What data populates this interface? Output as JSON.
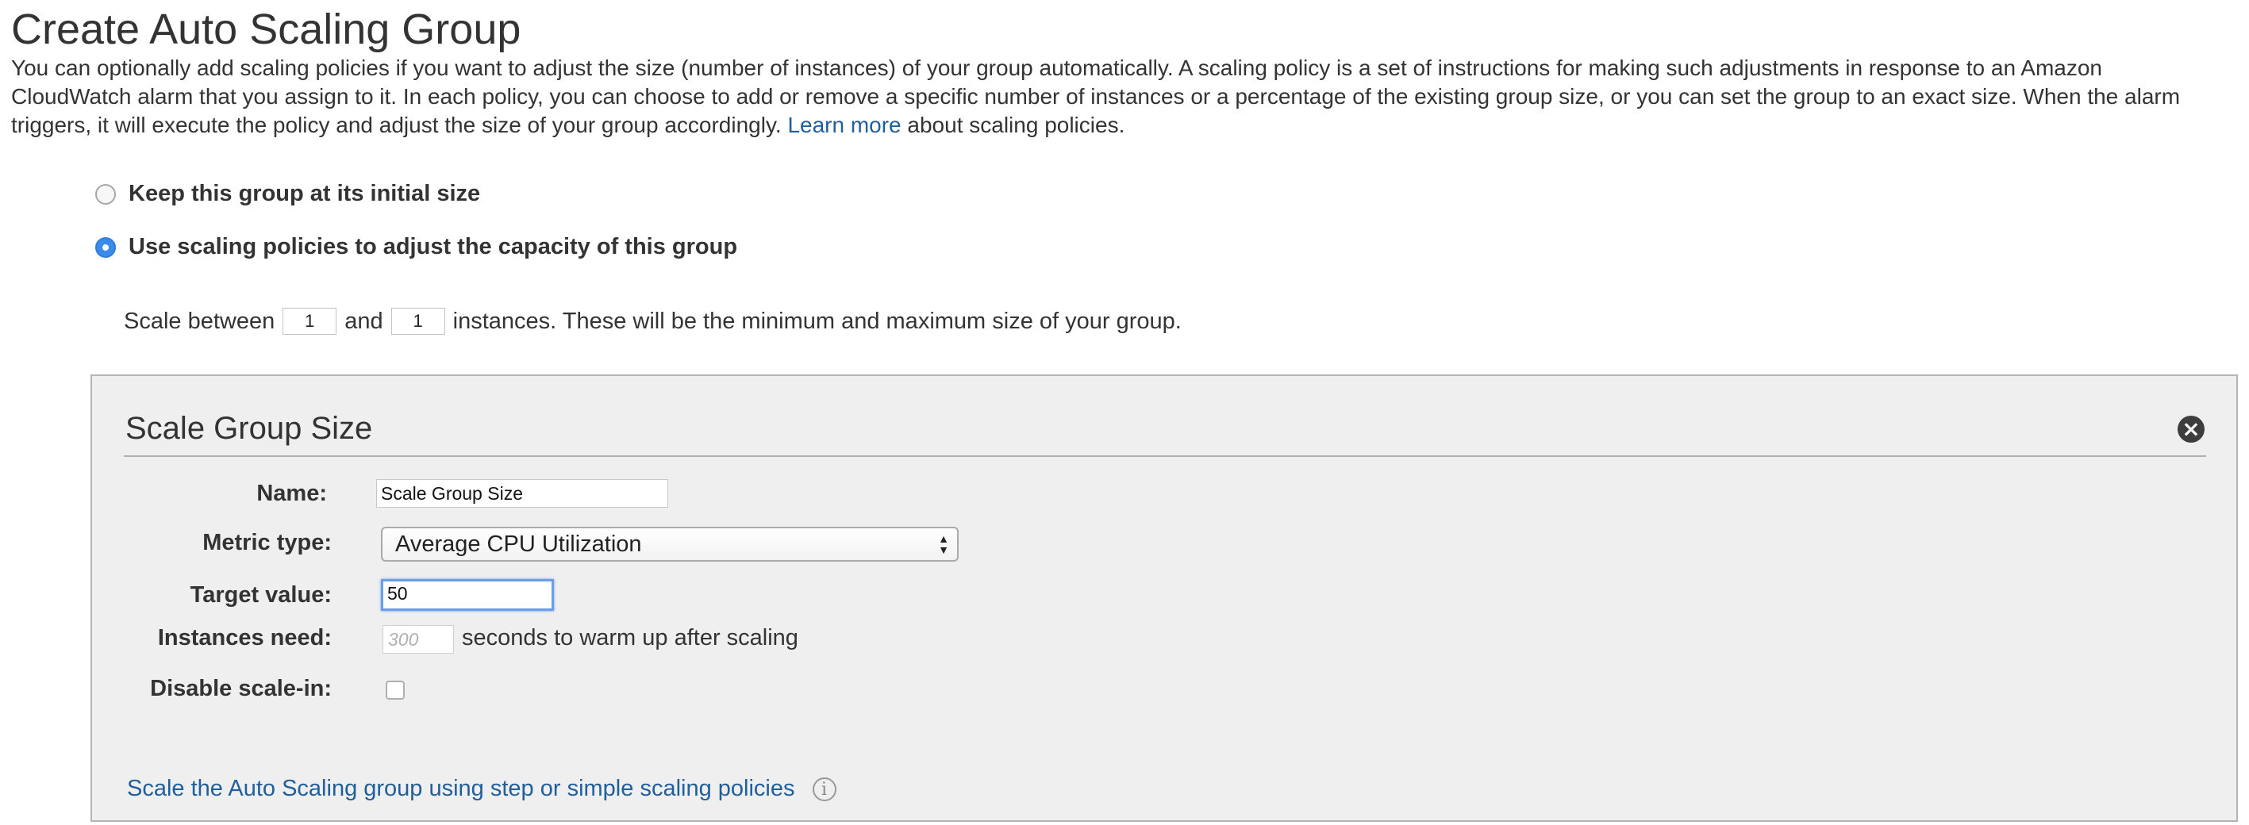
{
  "page": {
    "title": "Create Auto Scaling Group",
    "intro_text": "You can optionally add scaling policies if you want to adjust the size (number of instances) of your group automatically. A scaling policy is a set of instructions for making such adjustments in response to an Amazon CloudWatch alarm that you assign to it. In each policy, you can choose to add or remove a specific number of instances or a percentage of the existing group size, or you can set the group to an exact size. When the alarm triggers, it will execute the policy and adjust the size of your group accordingly.",
    "learn_more_label": "Learn more",
    "intro_suffix": "about scaling policies."
  },
  "options": {
    "keep_size_label": "Keep this group at its initial size",
    "keep_size_selected": false,
    "use_policies_label": "Use scaling policies to adjust the capacity of this group",
    "use_policies_selected": true
  },
  "scale_range": {
    "prefix": "Scale between",
    "min_value": "1",
    "conjunction": "and",
    "max_value": "1",
    "suffix": "instances. These will be the minimum and maximum size of your group."
  },
  "policy_panel": {
    "title": "Scale Group Size",
    "name_label": "Name:",
    "name_value": "Scale Group Size",
    "metric_type_label": "Metric type:",
    "metric_type_value": "Average CPU Utilization",
    "target_value_label": "Target value:",
    "target_value": "50",
    "instances_need_label": "Instances need:",
    "warmup_placeholder": "300",
    "warmup_suffix": "seconds to warm up after scaling",
    "disable_scale_in_label": "Disable scale-in:",
    "disable_scale_in_checked": false,
    "step_policies_link": "Scale the Auto Scaling group using step or simple scaling policies"
  },
  "icons": {
    "close": "close-icon",
    "info": "info-icon",
    "select_arrows": "select-arrows-icon"
  },
  "colors": {
    "link": "#1f5f9d",
    "radio_selected": "#3b8bec",
    "panel_background": "#efefef",
    "focus_ring": "#6a9ee8"
  }
}
